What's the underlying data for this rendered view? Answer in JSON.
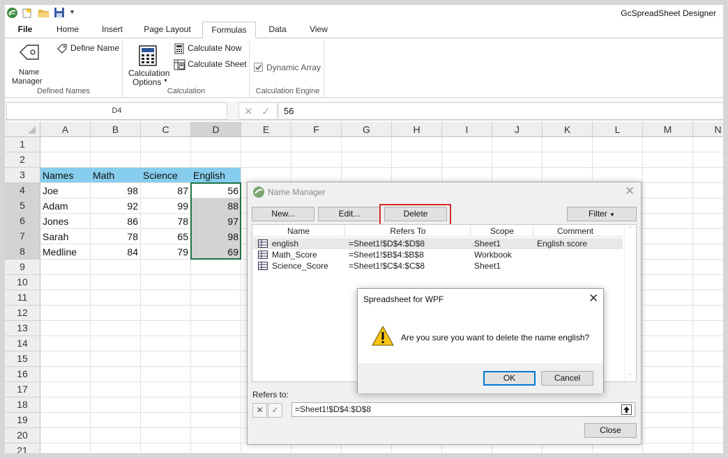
{
  "app": {
    "title": "GcSpreadSheet Designer"
  },
  "tabs": [
    "File",
    "Home",
    "Insert",
    "Page Layout",
    "Formulas",
    "Data",
    "View"
  ],
  "active_tab": "Formulas",
  "ribbon": {
    "name_manager_line1": "Name",
    "name_manager_line2": "Manager",
    "define_name": "Define Name",
    "group_defined_names": "Defined Names",
    "calc_options_line1": "Calculation",
    "calc_options_line2": "Options",
    "calculate_now": "Calculate Now",
    "calculate_sheet": "Calculate Sheet",
    "group_calculation": "Calculation",
    "dynamic_array": "Dynamic Array",
    "dynamic_array_checked": true,
    "group_calc_engine": "Calculation Engine"
  },
  "formula_bar": {
    "name_box": "D4",
    "value": "56"
  },
  "columns": [
    "A",
    "B",
    "C",
    "D",
    "E",
    "F",
    "G",
    "H",
    "I",
    "J",
    "K",
    "L",
    "M",
    "N"
  ],
  "rows": [
    "1",
    "2",
    "3",
    "4",
    "5",
    "6",
    "7",
    "8",
    "9",
    "10",
    "11",
    "12",
    "13",
    "14",
    "15",
    "16",
    "17",
    "18",
    "19",
    "20",
    "21"
  ],
  "sheet": {
    "headers": [
      "Names",
      "Math",
      "Science",
      "English"
    ],
    "data": [
      [
        "Joe",
        "98",
        "87",
        "56"
      ],
      [
        "Adam",
        "92",
        "99",
        "88"
      ],
      [
        "Jones",
        "86",
        "78",
        "97"
      ],
      [
        "Sarah",
        "78",
        "65",
        "98"
      ],
      [
        "Medline",
        "84",
        "79",
        "69"
      ]
    ]
  },
  "name_manager": {
    "title": "Name Manager",
    "new_btn": "New...",
    "edit_btn": "Edit...",
    "delete_btn": "Delete",
    "filter_btn": "Filter",
    "col_headers": [
      "Name",
      "Refers To",
      "Scope",
      "Comment"
    ],
    "names": [
      {
        "name": "english",
        "refers_to": "=Sheet1!$D$4:$D$8",
        "scope": "Sheet1",
        "comment": "English score"
      },
      {
        "name": "Math_Score",
        "refers_to": "=Sheet1!$B$4:$B$8",
        "scope": "Workbook",
        "comment": ""
      },
      {
        "name": "Science_Score",
        "refers_to": "=Sheet1!$C$4:$C$8",
        "scope": "Sheet1",
        "comment": ""
      }
    ],
    "refers_to_label": "Refers to:",
    "refers_to_value": "=Sheet1!$D$4:$D$8",
    "close_btn": "Close"
  },
  "confirm": {
    "title": "Spreadsheet for WPF",
    "message": "Are you sure you want to delete the name english?",
    "ok": "OK",
    "cancel": "Cancel"
  },
  "colors": {
    "header_fill": "#87cdee",
    "selection_fill": "#d3d3d3",
    "selection_border": "#217346",
    "highlight_box": "#d22b2b"
  }
}
